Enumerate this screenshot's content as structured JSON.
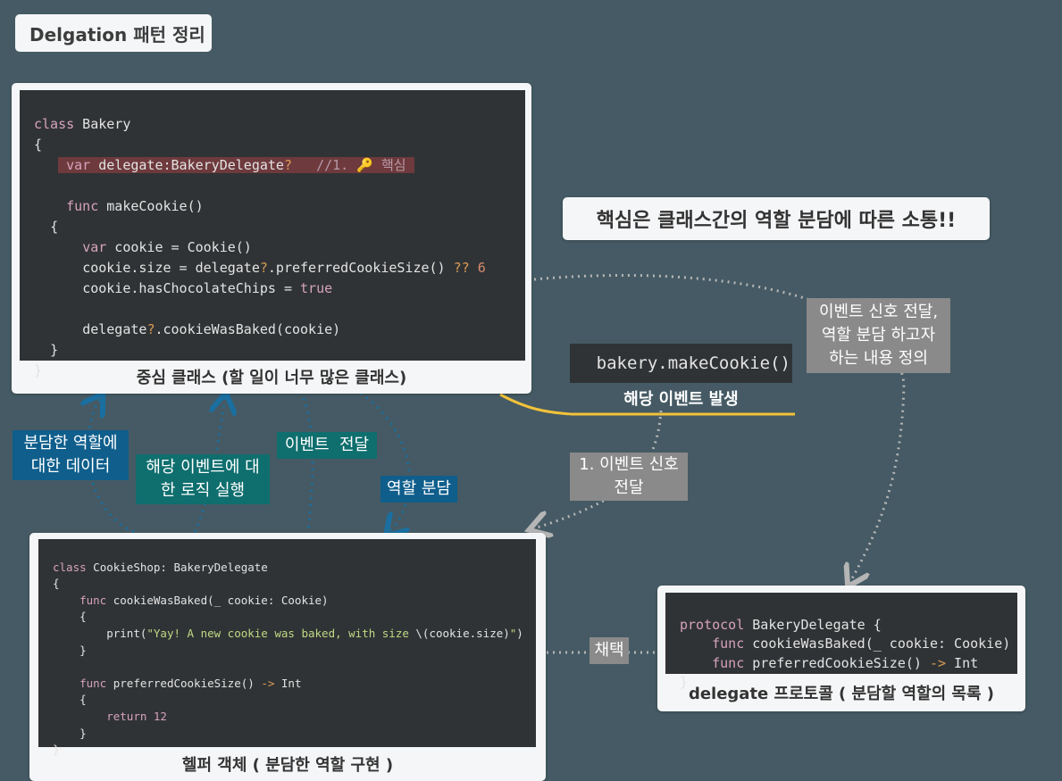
{
  "title": "Delgation 패턴 정리",
  "core_message": "핵심은 클래스간의 역할 분담에 따른 소통!!",
  "bakery_card": {
    "caption": "중심 클래스 (할 일이 너무 많은 클래스)",
    "code": {
      "l1_kw": "class",
      "l1_name": " Bakery",
      "l2": "{",
      "l3_kw": "var",
      "l3_rest": " delegate:BakeryDelegate",
      "l3_op": "?",
      "l3_comment": "//1. 🔑 핵심",
      "l4_kw": "func",
      "l4_rest": " makeCookie()",
      "l5": "{",
      "l6_kw": "var",
      "l6_rest": " cookie = Cookie()",
      "l7_a": "cookie.size = delegate",
      "l7_op": "?",
      "l7_b": ".preferredCookieSize() ",
      "l7_op2": "??",
      "l7_num": " 6",
      "l8_a": "cookie.hasChocolateChips = ",
      "l8_kw": "true",
      "l9_a": "delegate",
      "l9_op": "?",
      "l9_b": ".cookieWasBaked(cookie)",
      "l10": "}",
      "l11": "}"
    }
  },
  "event_card": {
    "code": "bakery.makeCookie()",
    "caption": "해당 이벤트 발생"
  },
  "cookieshop_card": {
    "caption": "헬퍼 객체 ( 분담한 역할 구현 )",
    "code": {
      "l1_kw": "class",
      "l1_rest": " CookieShop: BakeryDelegate",
      "l2": "{",
      "l3_kw": "func",
      "l3_rest": " cookieWasBaked(_ cookie: Cookie)",
      "l4": "{",
      "l5_a": "print(",
      "l5_str": "\"Yay! A new cookie was baked, with size ",
      "l5_b": "\\(cookie.size)",
      "l5_str2": "\"",
      "l5_c": ")",
      "l6": "}",
      "l7_kw": "func",
      "l7_rest": " preferredCookieSize() ",
      "l7_op": "->",
      "l7_type": " Int",
      "l8": "{",
      "l9_kw": "return",
      "l9_num": " 12",
      "l10": "}",
      "l11": "}"
    }
  },
  "protocol_card": {
    "caption": "delegate 프로토콜 ( 분담할 역할의 목록 )",
    "code": {
      "l1_kw": "protocol",
      "l1_rest": " BakeryDelegate {",
      "l2_kw": "func",
      "l2_rest": " cookieWasBaked(_ cookie: Cookie)",
      "l3_kw": "func",
      "l3_rest": " preferredCookieSize() ",
      "l3_op": "->",
      "l3_type": " Int",
      "l4": "}"
    }
  },
  "labels": {
    "role_data": "분담한 역할에\n대한 데이터",
    "run_logic": "해당 이벤트에 대\n한 로직 실행",
    "pass_event": "이벤트  전달",
    "assign_role": "역할 분담",
    "signal_pass": "1. 이벤트 신호\n전달",
    "define": "이벤트 신호 전달,\n역할 분담 하고자\n하는 내용 정의",
    "adopt": "채택"
  },
  "colors": {
    "background": "#455a64",
    "blue_label": "#0f5e8c",
    "teal_label": "#0f6e6e",
    "gray_label": "#8a8a8a",
    "highlight_underline": "#f2c23a"
  }
}
